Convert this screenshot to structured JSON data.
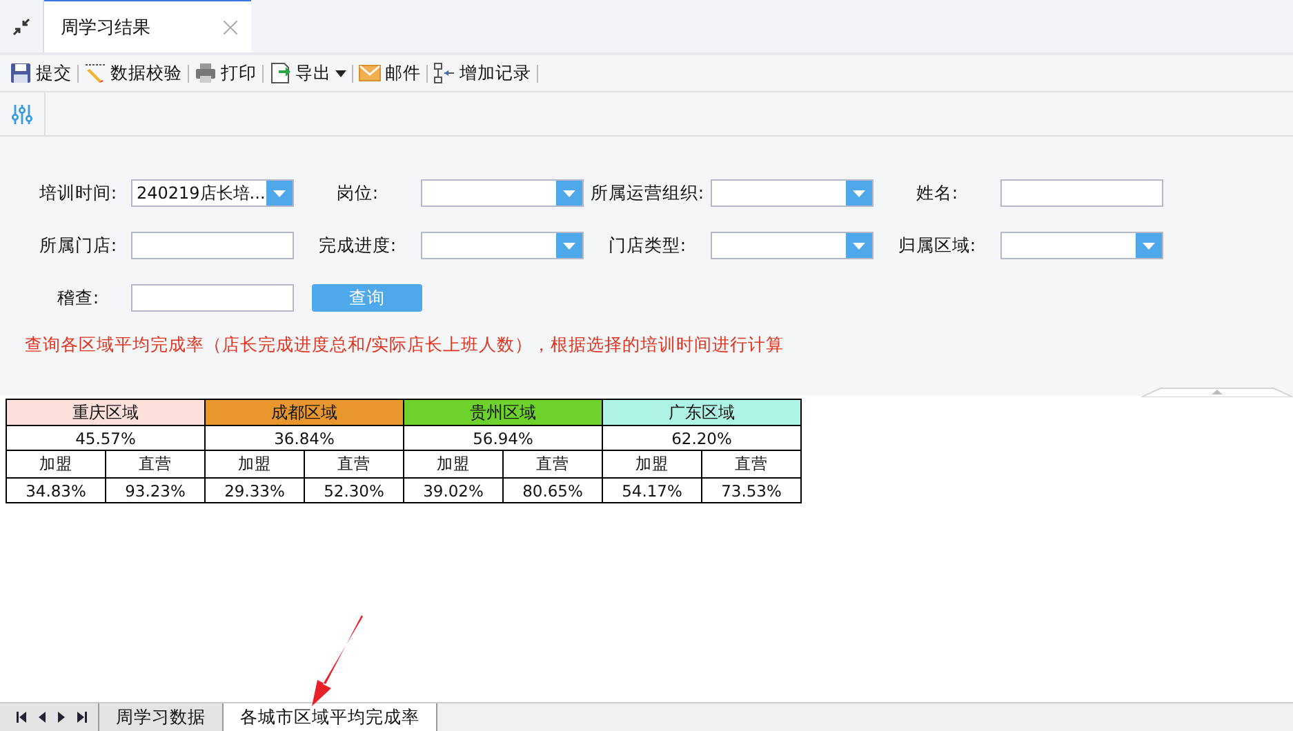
{
  "doc_tab": {
    "title": "周学习结果"
  },
  "toolbar": [
    {
      "label": "提交",
      "has_menu": false
    },
    {
      "label": "数据校验",
      "has_menu": false
    },
    {
      "label": "打印",
      "has_menu": false
    },
    {
      "label": "导出",
      "has_menu": true
    },
    {
      "label": "邮件",
      "has_menu": false
    },
    {
      "label": "增加记录",
      "has_menu": false
    }
  ],
  "form": {
    "rows": [
      [
        {
          "label": "培训时间:",
          "kind": "select",
          "value": "240219店长培..."
        },
        {
          "label": "岗位:",
          "kind": "select"
        },
        {
          "label": "所属运营组织:",
          "kind": "select"
        },
        {
          "label": "姓名:",
          "kind": "input"
        }
      ],
      [
        {
          "label": "所属门店:",
          "kind": "input"
        },
        {
          "label": "完成进度:",
          "kind": "select"
        },
        {
          "label": "门店类型:",
          "kind": "select"
        },
        {
          "label": "归属区域:",
          "kind": "select"
        }
      ],
      [
        {
          "label": "稽查:",
          "kind": "input"
        }
      ]
    ],
    "query_button": "查询",
    "note": "查询各区域平均完成率（店长完成进度总和/实际店长上班人数），根据选择的培训时间进行计算"
  },
  "report": {
    "regions": [
      {
        "name": "重庆区域",
        "color": "#fde0dc",
        "total": "45.57%",
        "franchise_label": "加盟",
        "direct_label": "直营",
        "franchise": "34.83%",
        "direct": "93.23%"
      },
      {
        "name": "成都区域",
        "color": "#e8962e",
        "total": "36.84%",
        "franchise_label": "加盟",
        "direct_label": "直营",
        "franchise": "29.33%",
        "direct": "52.30%"
      },
      {
        "name": "贵州区域",
        "color": "#6dd32c",
        "total": "56.94%",
        "franchise_label": "加盟",
        "direct_label": "直营",
        "franchise": "39.02%",
        "direct": "80.65%"
      },
      {
        "name": "广东区域",
        "color": "#aef3e6",
        "total": "62.20%",
        "franchise_label": "加盟",
        "direct_label": "直营",
        "franchise": "54.17%",
        "direct": "73.53%"
      }
    ]
  },
  "sheet_tabs": [
    {
      "label": "周学习数据",
      "selected": false
    },
    {
      "label": "各城市区域平均完成率",
      "selected": true
    }
  ]
}
